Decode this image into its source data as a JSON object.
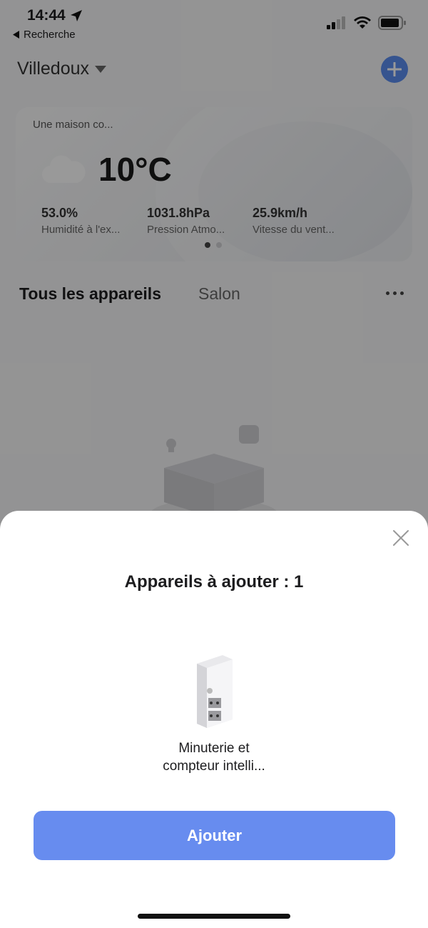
{
  "status_bar": {
    "time": "14:44",
    "back_label": "Recherche"
  },
  "header": {
    "home_name": "Villedoux"
  },
  "weather": {
    "card_title": "Une maison co...",
    "temperature": "10°C",
    "stats": [
      {
        "value": "53.0%",
        "label": "Humidité à l'ex..."
      },
      {
        "value": "1031.8hPa",
        "label": "Pression Atmo..."
      },
      {
        "value": "25.9km/h",
        "label": "Vitesse du vent..."
      }
    ]
  },
  "tabs": {
    "all_devices": "Tous les appareils",
    "room": "Salon"
  },
  "sheet": {
    "title": "Appareils à ajouter : 1",
    "device_name_line1": "Minuterie et",
    "device_name_line2": "compteur intelli...",
    "add_button_label": "Ajouter"
  },
  "colors": {
    "accent": "#5b8def",
    "button": "#678cef",
    "overlay": "rgba(0,0,0,0.40)"
  },
  "icons": [
    "location-arrow-icon",
    "back-triangle-icon",
    "signal-icon",
    "wifi-icon",
    "battery-icon",
    "dropdown-caret-icon",
    "plus-icon",
    "cloud-icon",
    "more-dots-icon",
    "close-icon"
  ]
}
